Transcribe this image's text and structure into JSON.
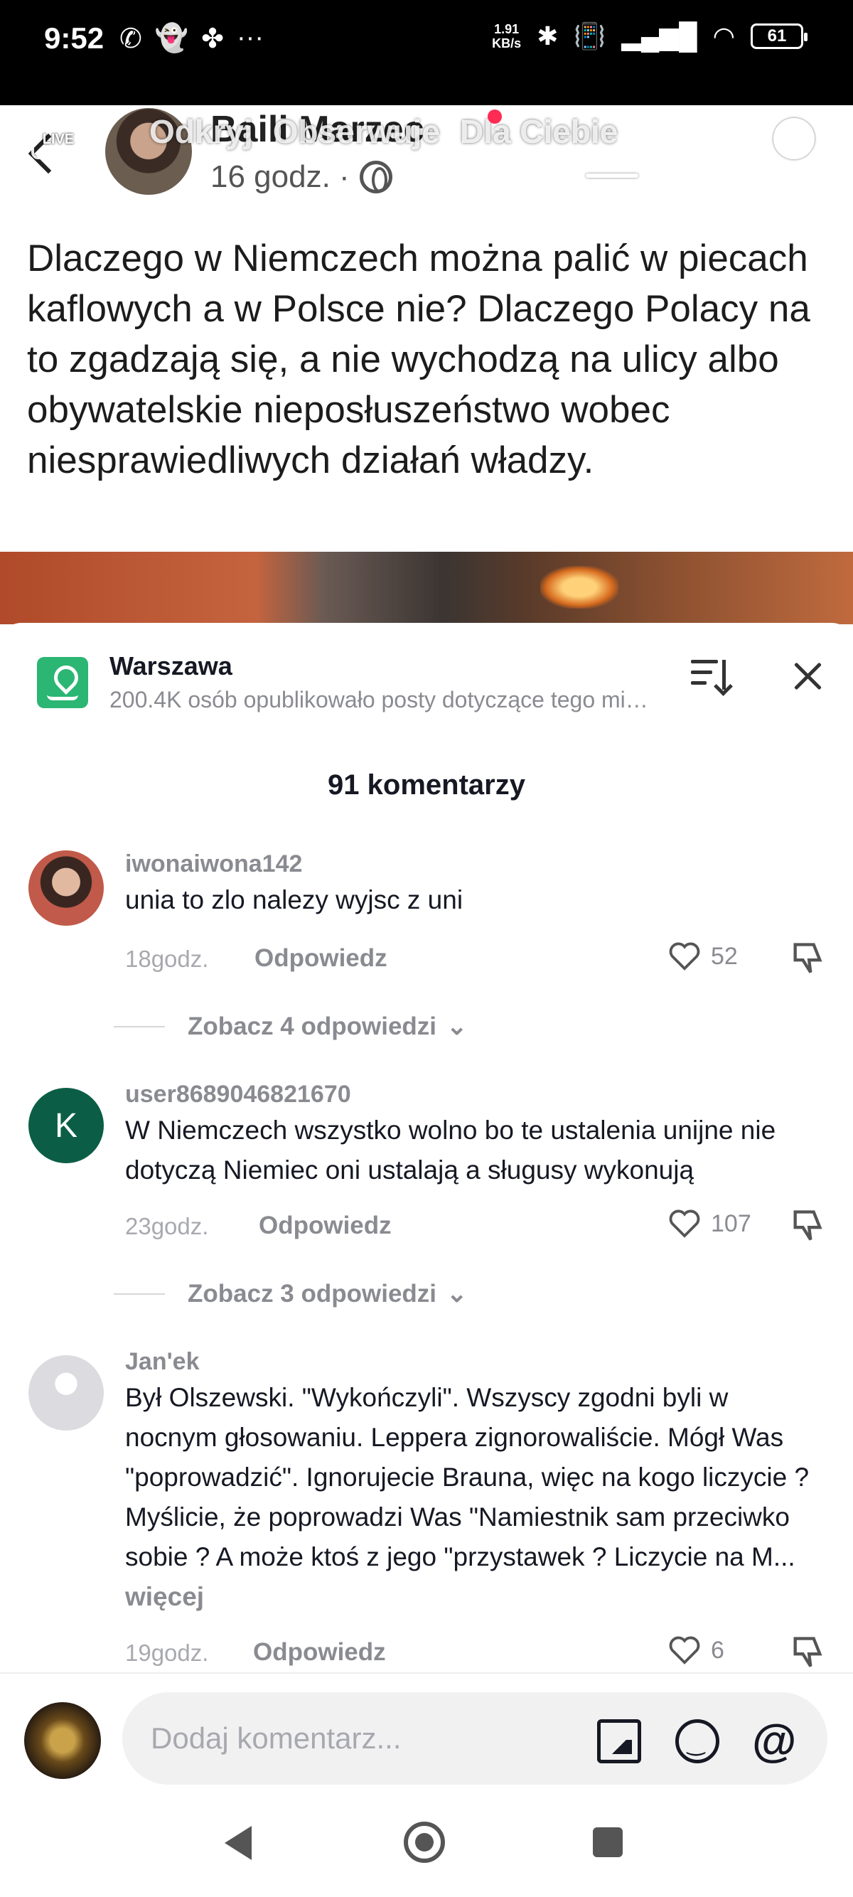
{
  "status_bar": {
    "time": "9:52",
    "left_icons": [
      "whatsapp-icon",
      "snapchat-icon",
      "pinwheel-icon",
      "more-dots-icon"
    ],
    "speed_value": "1.91",
    "speed_unit": "KB/s",
    "battery": "61"
  },
  "post": {
    "author": "Baili Marzec",
    "time": "16 godz. ·",
    "live_label": "LIVE",
    "top_tabs": [
      "Odkryj",
      "Obserwuje",
      "Dla Ciebie"
    ],
    "text": "Dlaczego w Niemczech można palić w piecach kaflowych a w Polsce nie? Dlaczego Polacy na to zgadzają się, a nie wychodzą na ulicy albo obywatelskie nieposłuszeństwo wobec niesprawiedliwych działań władzy."
  },
  "sheet": {
    "location_title": "Warszawa",
    "location_subtitle": "200.4K osób opublikowało posty dotyczące tego miejsca",
    "comment_count": "91 komentarzy",
    "comments": [
      {
        "user": "iwonaiwona142",
        "text": "unia to zlo nalezy wyjsc z uni",
        "time": "18godz.",
        "reply": "Odpowiedz",
        "likes": "52",
        "replies": "Zobacz 4 odpowiedzi"
      },
      {
        "user": "user8689046821670",
        "avatar_letter": "K",
        "text": "W Niemczech wszystko wolno bo te ustalenia unijne nie dotyczą Niemiec oni ustalają a sługusy wykonują",
        "time": "23godz.",
        "reply": "Odpowiedz",
        "likes": "107",
        "replies": "Zobacz 3 odpowiedzi"
      },
      {
        "user": "Jan'ek",
        "text": "Był Olszewski. \"Wykończyli\". Wszyscy zgodni byli w nocnym głosowaniu. Leppera zignorowaliście. Mógł Was \"poprowadzić\". Ignorujecie Brauna, więc na kogo liczycie ? Myślicie, że poprowadzi Was \"Namiestnik sam przeciwko sobie ? A może ktoś z jego \"przystawek ? Liczycie na M...",
        "more": "więcej",
        "time": "19godz.",
        "reply": "Odpowiedz",
        "likes": "6"
      }
    ]
  },
  "input": {
    "placeholder": "Dodaj komentarz..."
  },
  "colors": {
    "accent": "#fe2c55",
    "location_icon": "#2bb673",
    "avatar_k": "#0b5e45",
    "muted_text": "#8a8b91"
  }
}
